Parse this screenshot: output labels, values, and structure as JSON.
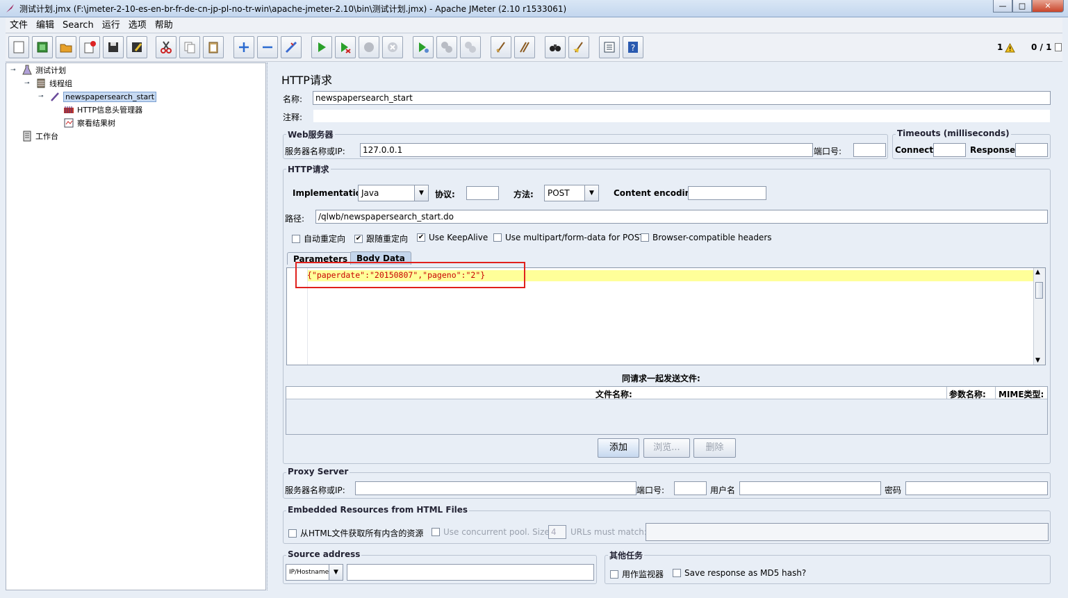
{
  "window": {
    "title": "测试计划.jmx (F:\\jmeter-2-10-es-en-br-fr-de-cn-jp-pl-no-tr-win\\apache-jmeter-2.10\\bin\\测试计划.jmx) - Apache JMeter (2.10 r1533061)",
    "minimize": "—",
    "maximize": "□",
    "close": "✕"
  },
  "menu": [
    "文件",
    "编辑",
    "Search",
    "运行",
    "选项",
    "帮助"
  ],
  "toolbar": {
    "warning_count": "1",
    "threads": "0 / 1"
  },
  "tree": {
    "test_plan": "测试计划",
    "thread_group": "线程组",
    "sampler": "newspapersearch_start",
    "header_manager": "HTTP信息头管理器",
    "results_tree": "察看结果树",
    "workbench": "工作台"
  },
  "form": {
    "title": "HTTP请求",
    "name_label": "名称:",
    "name_value": "newspapersearch_start",
    "comment_label": "注释:",
    "web_server": {
      "legend": "Web服务器",
      "server_label": "服务器名称或IP:",
      "server_value": "127.0.0.1",
      "port_label": "端口号:",
      "port_value": ""
    },
    "timeouts": {
      "legend": "Timeouts (milliseconds)",
      "connect_label": "Connect:",
      "response_label": "Response:"
    },
    "http_request": {
      "legend": "HTTP请求",
      "impl_label": "Implementation:",
      "impl_value": "Java",
      "protocol_label": "协议:",
      "method_label": "方法:",
      "method_value": "POST",
      "encoding_label": "Content encoding:",
      "path_label": "路径:",
      "path_value": "/qlwb/newspapersearch_start.do"
    },
    "options": [
      {
        "label": "自动重定向",
        "checked": false
      },
      {
        "label": "跟随重定向",
        "checked": true
      },
      {
        "label": "Use KeepAlive",
        "checked": true
      },
      {
        "label": "Use multipart/form-data for POST",
        "checked": false
      },
      {
        "label": "Browser-compatible headers",
        "checked": false
      }
    ],
    "tabs": [
      "Parameters",
      "Body Data"
    ],
    "body_data": "{\"paperdate\":\"20150807\",\"pageno\":\"2\"}",
    "files": {
      "title": "同请求一起发送文件:",
      "col_filename": "文件名称:",
      "col_param": "参数名称:",
      "col_mime": "MIME类型:",
      "add": "添加",
      "browse": "浏览...",
      "delete": "删除"
    },
    "proxy": {
      "legend": "Proxy Server",
      "server_label": "服务器名称或IP:",
      "port_label": "端口号:",
      "user_label": "用户名",
      "password_label": "密码"
    },
    "embedded": {
      "legend": "Embedded Resources from HTML Files",
      "retrieve_label": "从HTML文件获取所有内含的资源",
      "concurrent_label": "Use concurrent pool. Size:",
      "pool_size": "4",
      "urls_label": "URLs must match:"
    },
    "source": {
      "legend": "Source address",
      "type_value": "IP/Hostname"
    },
    "other": {
      "legend": "其他任务",
      "monitor_label": "用作监视器",
      "md5_label": "Save response as MD5 hash?"
    }
  },
  "colors": {
    "highlight_box": "#e0201c",
    "editor_line": "#ffff99",
    "json_text": "#c80000"
  }
}
